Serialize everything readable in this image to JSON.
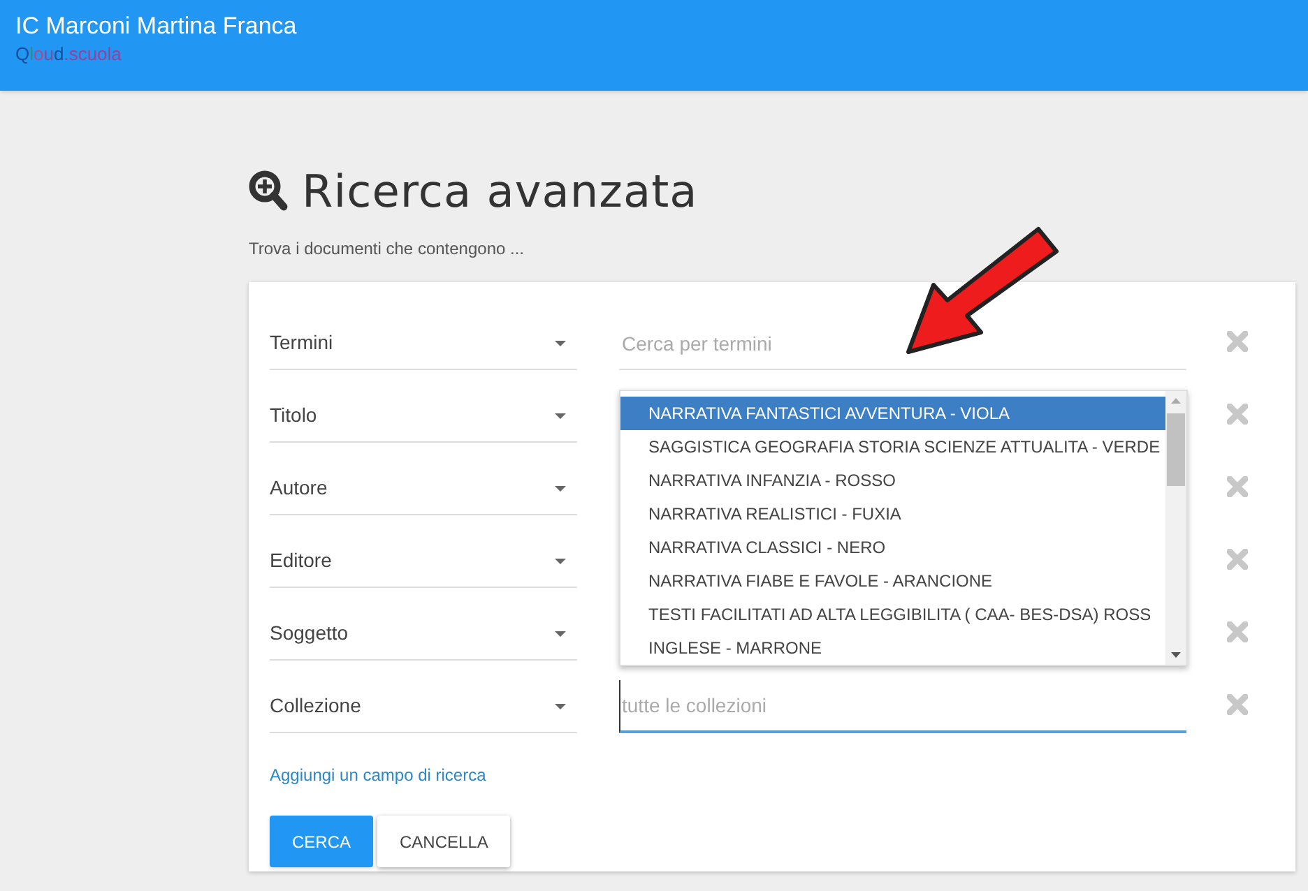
{
  "header": {
    "title": "IC Marconi Martina Franca",
    "logo": [
      {
        "text": "Q",
        "color": "#1a4f9c"
      },
      {
        "text": "l",
        "color": "#2e8b8b"
      },
      {
        "text": "o",
        "color": "#b0488f"
      },
      {
        "text": "u",
        "color": "#7a4fa0"
      },
      {
        "text": "d",
        "color": "#1a4f9c"
      },
      {
        "text": ".scuola",
        "color": "#9c3f9a"
      }
    ]
  },
  "page": {
    "title": "Ricerca avanzata",
    "subtitle": "Trova i documenti che contengono ..."
  },
  "rows": [
    {
      "field": "Termini",
      "placeholder": "Cerca per termini",
      "focused": false
    },
    {
      "field": "Titolo"
    },
    {
      "field": "Autore"
    },
    {
      "field": "Editore"
    },
    {
      "field": "Soggetto"
    },
    {
      "field": "Collezione",
      "placeholder": "tutte le collezioni",
      "focused": true
    }
  ],
  "dropdown": {
    "options": [
      {
        "label": "NARRATIVA FANTASTICI AVVENTURA - VIOLA",
        "selected": true
      },
      {
        "label": "SAGGISTICA GEOGRAFIA STORIA SCIENZE ATTUALITA - VERDE",
        "selected": false
      },
      {
        "label": "NARRATIVA INFANZIA - ROSSO",
        "selected": false
      },
      {
        "label": "NARRATIVA REALISTICI - FUXIA",
        "selected": false
      },
      {
        "label": "NARRATIVA CLASSICI - NERO",
        "selected": false
      },
      {
        "label": "NARRATIVA FIABE E FAVOLE - ARANCIONE",
        "selected": false
      },
      {
        "label": "TESTI FACILITATI AD ALTA LEGGIBILITA ( CAA- BES-DSA) ROSS",
        "selected": false
      },
      {
        "label": "INGLESE - MARRONE",
        "selected": false
      }
    ]
  },
  "add_field_link": "Aggiungi un campo di ricerca",
  "buttons": [
    {
      "label": "CERCA",
      "kind": "primary"
    },
    {
      "label": "CANCELLA",
      "kind": "secondary"
    }
  ]
}
